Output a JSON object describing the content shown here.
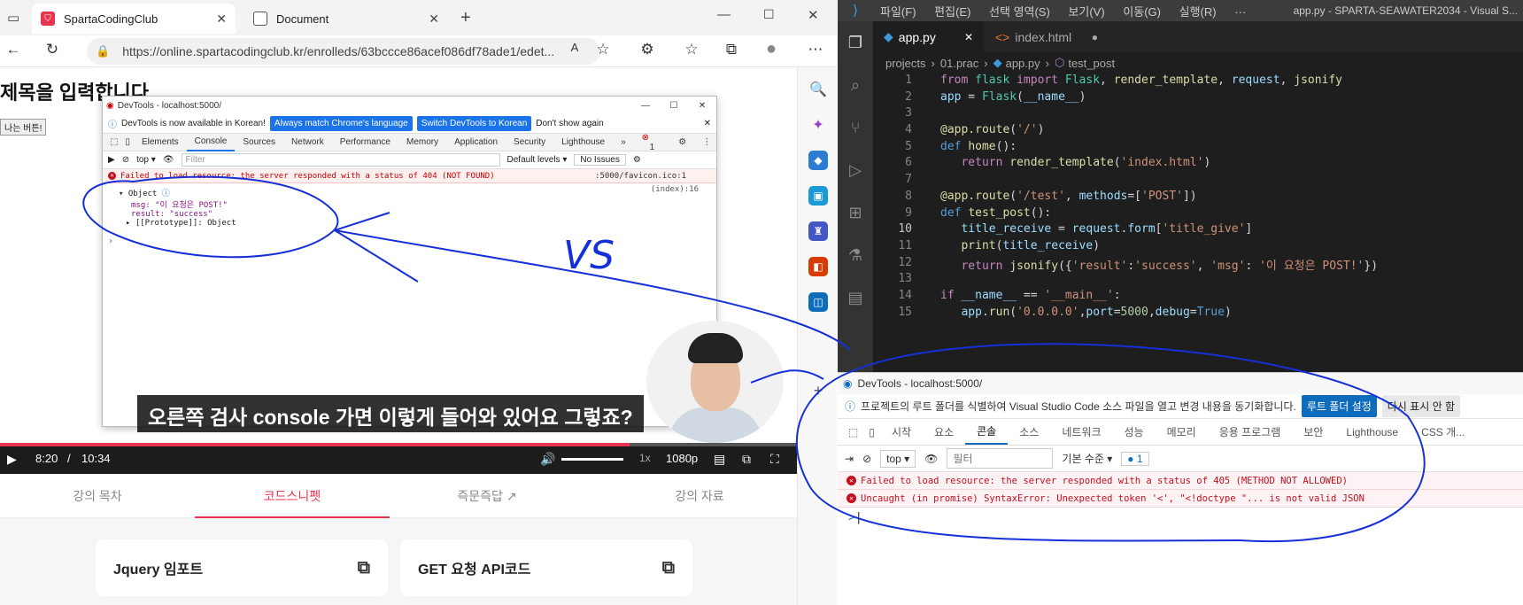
{
  "browser": {
    "tabs": [
      {
        "label": "SpartaCodingClub",
        "active": true
      },
      {
        "label": "Document",
        "active": false
      }
    ],
    "url": "https://online.spartacodingclub.kr/enrolleds/63bccce86acef086df78ade1/edet...",
    "page_title": "제목을 입력합니다",
    "page_button": "나는 버튼!"
  },
  "chrome_devtools": {
    "title": "DevTools - localhost:5000/",
    "info_text": "DevTools is now available in Korean!",
    "btn_match": "Always match Chrome's language",
    "btn_switch": "Switch DevTools to Korean",
    "btn_dont": "Don't show again",
    "tabs": [
      "Elements",
      "Console",
      "Sources",
      "Network",
      "Performance",
      "Memory",
      "Application",
      "Security",
      "Lighthouse"
    ],
    "error_badge": "1",
    "context": "top",
    "filter_placeholder": "Filter",
    "levels": "Default levels",
    "issues": "No Issues",
    "error_text": "Failed to load resource: the server responded with a status of 404 (NOT FOUND)",
    "error_source": ":5000/favicon.ico:1",
    "log_source": "(index):16",
    "obj_label": "Object",
    "obj_msg": "msg: \"이 요청은 POST!\"",
    "obj_result": "result: \"success\"",
    "obj_proto": "[[Prototype]]: Object"
  },
  "video": {
    "subtitle": "오른쪽 검사 console 가면 이렇게 들어와 있어요 그렇죠?",
    "current_time": "8:20",
    "separator": "/",
    "duration": "10:34",
    "progress_fraction": 0.79,
    "speed": "1x",
    "quality": "1080p"
  },
  "lecture_tabs": [
    "강의 목차",
    "코드스니펫",
    "즉문즉답",
    "강의 자료"
  ],
  "selected_lecture_tab": 1,
  "snippets": [
    "Jquery 임포트",
    "GET 요청 API코드"
  ],
  "vscode": {
    "menu": [
      "파일(F)",
      "편집(E)",
      "선택 영역(S)",
      "보기(V)",
      "이동(G)",
      "실행(R)",
      "···"
    ],
    "window_title": "app.py - SPARTA-SEAWATER2034 - Visual S...",
    "tabs": [
      "app.py",
      "index.html"
    ],
    "breadcrumb": [
      "projects",
      "01.prac",
      "app.py",
      "test_post"
    ],
    "current_line": 10
  },
  "edge_devtools": {
    "title": "DevTools - localhost:5000/",
    "info_text": "프로젝트의 루트 폴더를 식별하여 Visual Studio Code 소스 파일을 열고 변경 내용을 동기화합니다.",
    "btn_root": "루트 폴더 설정",
    "btn_hide": "다시 표시 안 함",
    "tabs": [
      "시작",
      "요소",
      "콘솔",
      "소스",
      "네트워크",
      "성능",
      "메모리",
      "응용 프로그램",
      "보안",
      "Lighthouse",
      "CSS 개..."
    ],
    "selected_tab": 2,
    "context": "top",
    "filter_placeholder": "필터",
    "levels": "기본 수준",
    "badge": "1",
    "errors": [
      "Failed to load resource: the server responded with a status of 405 (METHOD NOT ALLOWED)",
      "Uncaught (in promise) SyntaxError: Unexpected token '<', \"<!doctype \"... is not valid JSON"
    ],
    "prompt": ">"
  },
  "annotation": {
    "label": "VS",
    "color": "#1530d8"
  },
  "colors": {
    "accent_red": "#e8344e",
    "vscode_bg": "#1e1e1e",
    "devtools_blue": "#1a73e8",
    "edge_blue": "#0f6cbd"
  }
}
